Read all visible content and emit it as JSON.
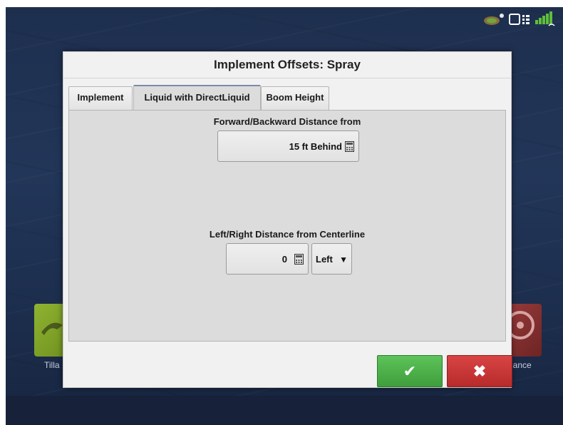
{
  "dialog": {
    "title": "Implement Offsets: Spray",
    "tabs": [
      {
        "label": "Implement"
      },
      {
        "label": "Liquid with DirectLiquid"
      },
      {
        "label": "Boom Height"
      }
    ],
    "forward_backward": {
      "label": "Forward/Backward Distance from",
      "value": "15 ft Behind"
    },
    "left_right": {
      "label": "Left/Right Distance from Centerline",
      "value": "0",
      "direction": "Left"
    },
    "ok_icon": "checkmark-icon",
    "cancel_icon": "close-icon"
  },
  "background": {
    "tillage_label": "Tilla",
    "guidance_label": "dance"
  },
  "status": {
    "icons": [
      "gps-icon",
      "display-icon",
      "signal-icon"
    ]
  },
  "colors": {
    "ok": "#4caf50",
    "cancel": "#c62828",
    "tillage_tile": "#8fb331",
    "guidance_tile": "#9a3c3c"
  }
}
